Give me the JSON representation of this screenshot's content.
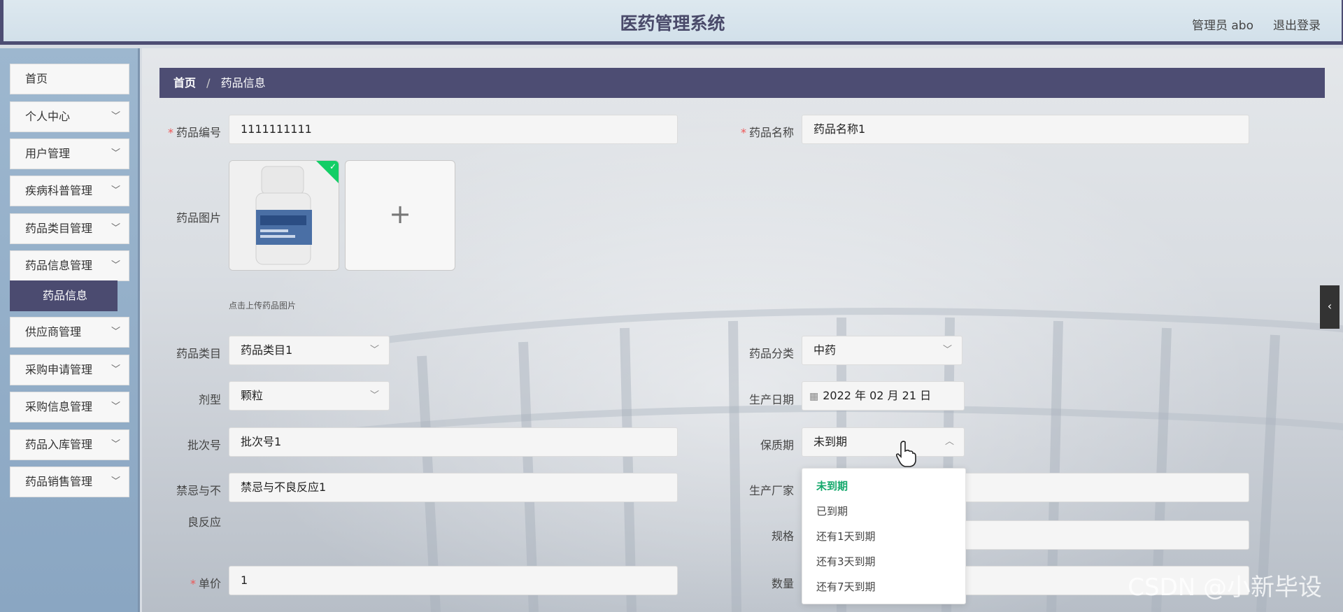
{
  "header": {
    "title": "医药管理系统",
    "user": "管理员 abo",
    "logout": "退出登录"
  },
  "sidebar": {
    "items": [
      {
        "label": "首页"
      },
      {
        "label": "个人中心"
      },
      {
        "label": "用户管理"
      },
      {
        "label": "疾病科普管理"
      },
      {
        "label": "药品类目管理"
      },
      {
        "label": "药品信息管理"
      },
      {
        "label": "药品信息"
      },
      {
        "label": "供应商管理"
      },
      {
        "label": "采购申请管理"
      },
      {
        "label": "采购信息管理"
      },
      {
        "label": "药品入库管理"
      },
      {
        "label": "药品销售管理"
      }
    ]
  },
  "breadcrumb": {
    "home": "首页",
    "sep": "/",
    "current": "药品信息"
  },
  "form": {
    "code_label": "药品编号",
    "code_value": "1111111111",
    "name_label": "药品名称",
    "name_value": "药品名称1",
    "image_label": "药品图片",
    "image_tip": "点击上传药品图片",
    "plus": "+",
    "category_label": "药品类目",
    "category_value": "药品类目1",
    "class_label": "药品分类",
    "class_value": "中药",
    "form_label": "剂型",
    "form_value": "颗粒",
    "date_label": "生产日期",
    "date_value": "2022 年 02 月 21 日",
    "batch_label": "批次号",
    "batch_value": "批次号1",
    "shelf_label": "保质期",
    "shelf_value": "未到期",
    "taboo_label_1": "禁忌与不",
    "taboo_label_2": "良反应",
    "taboo_value": "禁忌与不良反应1",
    "maker_label": "生产厂家",
    "spec_label": "规格",
    "price_label": "单价",
    "price_value": "1",
    "qty_label": "数量",
    "required_mark": "*"
  },
  "shelf_options": [
    {
      "label": "未到期",
      "selected": true
    },
    {
      "label": "已到期"
    },
    {
      "label": "还有1天到期"
    },
    {
      "label": "还有3天到期"
    },
    {
      "label": "还有7天到期"
    }
  ],
  "icons": {
    "chevron": "chevron-down-icon",
    "calendar": "calendar-icon",
    "check": "check-icon",
    "collapse": "chevron-left-icon"
  },
  "colors": {
    "primary": "#4d4d73",
    "selected_option": "#13a86b",
    "upload_badge": "#13ce66"
  },
  "watermark": "CSDN @小新毕设"
}
